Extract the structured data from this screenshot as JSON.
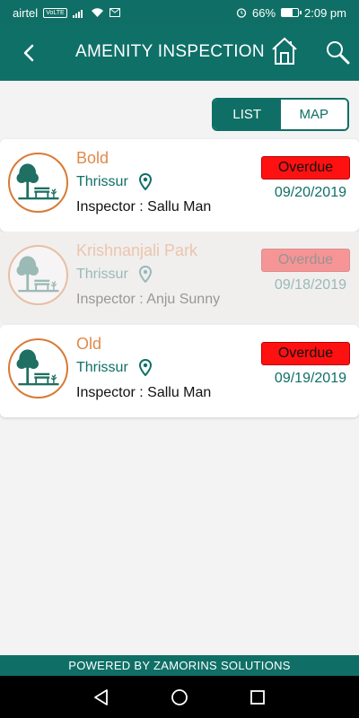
{
  "status_bar": {
    "carrier": "airtel",
    "network_tag": "VoLTE",
    "battery_percent": "66%",
    "battery_level": 0.66,
    "time": "2:09 pm",
    "icons": [
      "signal-icon",
      "wifi-icon",
      "mail-icon",
      "alarm-icon",
      "battery-icon"
    ]
  },
  "header": {
    "title": "AMENITY INSPECTION",
    "back_icon": "back-arrow-icon",
    "home_icon": "home-icon",
    "search_icon": "search-icon"
  },
  "view_toggle": {
    "list_label": "LIST",
    "map_label": "MAP",
    "selected": "LIST"
  },
  "inspections": [
    {
      "name": "Bold",
      "location": "Thrissur",
      "inspector": "Inspector : Sallu Man",
      "status": "Overdue",
      "date": "09/20/2019",
      "dimmed": false
    },
    {
      "name": "Krishnanjali Park",
      "location": "Thrissur",
      "inspector": "Inspector : Anju Sunny",
      "status": "Overdue",
      "date": "09/18/2019",
      "dimmed": true
    },
    {
      "name": "Old",
      "location": "Thrissur",
      "inspector": "Inspector : Sallu Man",
      "status": "Overdue",
      "date": "09/19/2019",
      "dimmed": false
    }
  ],
  "footer": {
    "powered_by": "POWERED BY ZAMORINS SOLUTIONS"
  },
  "colors": {
    "primary": "#0f6f66",
    "accent": "#e08a4c",
    "overdue": "#ff1111"
  }
}
